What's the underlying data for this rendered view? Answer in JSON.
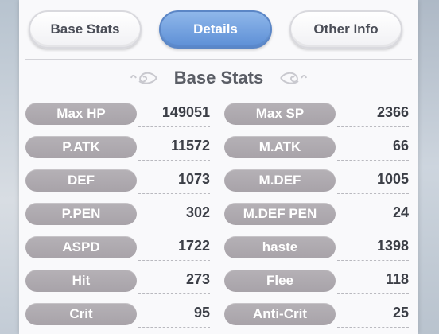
{
  "tabs": [
    {
      "label": "Base Stats",
      "active": false
    },
    {
      "label": "Details",
      "active": true
    },
    {
      "label": "Other Info",
      "active": false
    }
  ],
  "section": {
    "title": "Base Stats"
  },
  "stats": [
    {
      "left": {
        "label": "Max HP",
        "value": "149051"
      },
      "right": {
        "label": "Max SP",
        "value": "2366"
      }
    },
    {
      "left": {
        "label": "P.ATK",
        "value": "11572"
      },
      "right": {
        "label": "M.ATK",
        "value": "66"
      }
    },
    {
      "left": {
        "label": "DEF",
        "value": "1073"
      },
      "right": {
        "label": "M.DEF",
        "value": "1005"
      }
    },
    {
      "left": {
        "label": "P.PEN",
        "value": "302"
      },
      "right": {
        "label": "M.DEF PEN",
        "value": "24"
      }
    },
    {
      "left": {
        "label": "ASPD",
        "value": "1722"
      },
      "right": {
        "label": "haste",
        "value": "1398"
      }
    },
    {
      "left": {
        "label": "Hit",
        "value": "273"
      },
      "right": {
        "label": "Flee",
        "value": "118"
      }
    },
    {
      "left": {
        "label": "Crit",
        "value": "95"
      },
      "right": {
        "label": "Anti-Crit",
        "value": "25"
      }
    }
  ],
  "colors": {
    "active_tab": "#6b9ade",
    "stat_pill": "#aea9af",
    "value_text": "#3c3f47"
  },
  "icons": {
    "ornament": "scroll-flourish-icon"
  }
}
